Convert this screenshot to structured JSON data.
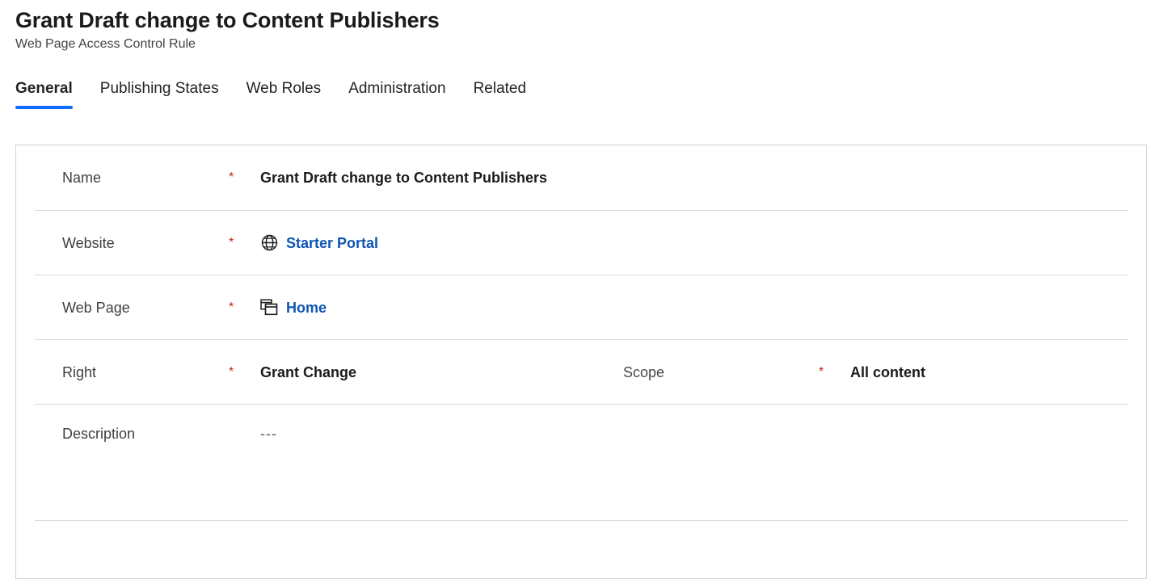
{
  "header": {
    "title": "Grant Draft change to Content Publishers",
    "subtitle": "Web Page Access Control Rule"
  },
  "tabs": [
    {
      "label": "General",
      "active": true
    },
    {
      "label": "Publishing States",
      "active": false
    },
    {
      "label": "Web Roles",
      "active": false
    },
    {
      "label": "Administration",
      "active": false
    },
    {
      "label": "Related",
      "active": false
    }
  ],
  "form": {
    "required_marker": "*",
    "rows": [
      {
        "label": "Name",
        "required": true,
        "value": "Grant Draft change to Content Publishers",
        "icon": null,
        "style": "text"
      },
      {
        "label": "Website",
        "required": true,
        "value": "Starter Portal",
        "icon": "globe-icon",
        "style": "link"
      },
      {
        "label": "Web Page",
        "required": true,
        "value": "Home",
        "icon": "pages-icon",
        "style": "link"
      },
      {
        "label": "Right",
        "required": true,
        "value": "Grant Change",
        "icon": null,
        "style": "text"
      },
      {
        "label": "Description",
        "required": false,
        "value": "---",
        "icon": null,
        "style": "plain"
      }
    ],
    "scope_field": {
      "label": "Scope",
      "required": true,
      "value": "All content"
    }
  },
  "colors": {
    "accent": "#0f6cff",
    "link": "#0f56b3",
    "required": "#c4271c",
    "label": "#3f3f3f",
    "border": "#d1d1d1",
    "divider": "#d9d9d9"
  }
}
